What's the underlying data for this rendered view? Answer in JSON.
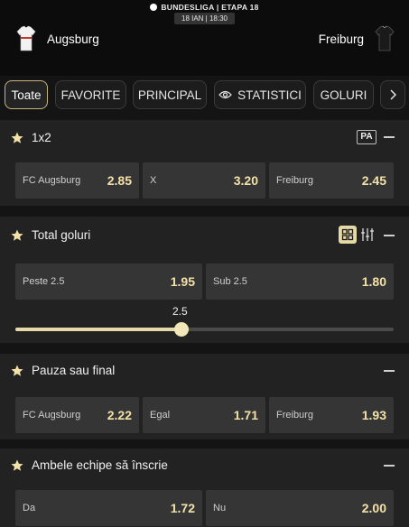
{
  "header": {
    "league": "BUNDESLIGA",
    "stage": "ETAPA 18",
    "datetime": "18 IAN | 18:30",
    "home_team": "Augsburg",
    "away_team": "Freiburg"
  },
  "tabs": [
    {
      "label": "Toate",
      "active": true
    },
    {
      "label": "FAVORITE",
      "active": false
    },
    {
      "label": "PRINCIPAL",
      "active": false
    },
    {
      "label": "STATISTICI",
      "active": false,
      "icon": "eye-icon"
    },
    {
      "label": "GOLURI",
      "active": false
    },
    {
      "label": "",
      "icon": "chevron-right-icon"
    }
  ],
  "markets": {
    "m1x2": {
      "title": "1x2",
      "badge": "PA",
      "odds": [
        {
          "label": "FC Augsburg",
          "value": "2.85"
        },
        {
          "label": "X",
          "value": "3.20"
        },
        {
          "label": "Freiburg",
          "value": "2.45"
        }
      ]
    },
    "total_goluri": {
      "title": "Total goluri",
      "odds": [
        {
          "label": "Peste 2.5",
          "value": "1.95"
        },
        {
          "label": "Sub 2.5",
          "value": "1.80"
        }
      ],
      "slider": {
        "value": "2.5",
        "fraction": 0.44
      }
    },
    "pauza": {
      "title": "Pauza sau final",
      "odds": [
        {
          "label": "FC Augsburg",
          "value": "2.22"
        },
        {
          "label": "Egal",
          "value": "1.71"
        },
        {
          "label": "Freiburg",
          "value": "1.93"
        }
      ]
    },
    "ambele": {
      "title": "Ambele echipe să înscrie",
      "odds": [
        {
          "label": "Da",
          "value": "1.72"
        },
        {
          "label": "Nu",
          "value": "2.00"
        }
      ]
    }
  },
  "colors": {
    "accent": "#c8b47a",
    "odds_value": "#f3e2a8",
    "panel_bg": "#222222",
    "odd_bg": "#353535"
  }
}
